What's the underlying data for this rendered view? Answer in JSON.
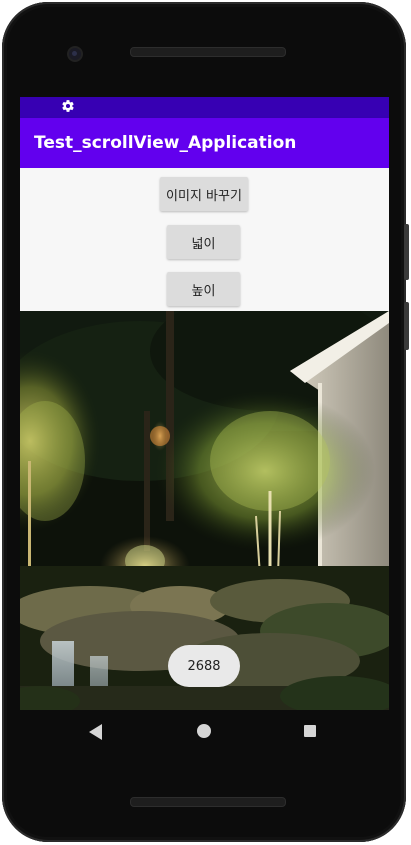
{
  "app": {
    "title": "Test_scrollView_Application"
  },
  "status_bar": {
    "icons": [
      "gear-icon"
    ]
  },
  "buttons": {
    "change_image": "이미지 바꾸기",
    "width": "넓이",
    "height": "높이"
  },
  "image": {
    "subject": "night garden with illuminated trees, waterfall and house"
  },
  "toast": {
    "message": "2688"
  },
  "nav_bar": {
    "icons": [
      "back-icon",
      "home-icon",
      "recents-icon"
    ]
  },
  "colors": {
    "status_bar": "#3700b3",
    "app_bar": "#6200ee",
    "button": "#dcdcdc",
    "toast": "#e9e9e9"
  }
}
